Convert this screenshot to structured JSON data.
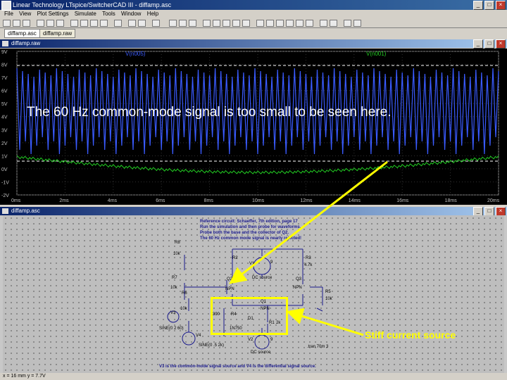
{
  "app": {
    "title": "Linear Technology LTspice/SwitcherCAD III - diffamp.asc"
  },
  "menu": [
    "File",
    "View",
    "Plot Settings",
    "Simulate",
    "Tools",
    "Window",
    "Help"
  ],
  "doc_tabs": [
    "diffamp.asc",
    "diffamp.raw"
  ],
  "waveform_pane": {
    "title": "diffamp.raw",
    "trace_labels": [
      "V(n005)",
      "V(n001)"
    ],
    "trace_colors": [
      "#3a5bff",
      "#22cc22"
    ],
    "y_ticks": [
      "9V",
      "8V",
      "7V",
      "6V",
      "5V",
      "4V",
      "3V",
      "2V",
      "1V",
      "0V",
      "-1V",
      "-2V"
    ],
    "x_ticks": [
      "0ms",
      "2ms",
      "4ms",
      "6ms",
      "8ms",
      "10ms",
      "12ms",
      "14ms",
      "16ms",
      "18ms",
      "20ms"
    ]
  },
  "schematic_pane": {
    "title": "diffamp.asc",
    "notes": [
      "Reference circuit: Schaeffer, 7th edition, page 17",
      "Run the simulation and then probe for waveforms.",
      "Probe both the base and the collector of Q2.",
      "The 60 Hz common mode signal is nearly rejected!"
    ],
    "bottom_note": "V3 is the common-mode signal source and V4 is the differential signal source.",
    "tran": ".tran 70m 3",
    "components": {
      "r8": "R8",
      "r8v": "10k",
      "r7": "R7",
      "r7v": "10k",
      "r6": "R6",
      "r6v": "10k",
      "r3": "R3",
      "r3v": "4.7k",
      "r2": "R2",
      "r4": "R4",
      "r4v": "390",
      "r5": "R5",
      "r5v": "10k",
      "r1": "R1",
      "r1v": "2k",
      "q2": "Q2",
      "q1": "Q1",
      "q3": "Q3",
      "npn": "NPN",
      "d1": "D1",
      "d1v": "1N750",
      "v1": "V1",
      "v2": "V2",
      "v3": "V3",
      "v4": "V4",
      "v1v": "DC source",
      "v2v": "DC source",
      "v3v": "SINE(0 2 60)",
      "v4v": "SINE(0 .5 2k)",
      "nine": "9"
    }
  },
  "annotations": {
    "overlay_main": "The 60 Hz common-mode signal is too small to be seen here.",
    "stiff_label": "Stiff current source",
    "arrow_color": "#ffff00"
  },
  "status": "x = 16 mm   y = 7.7V"
}
